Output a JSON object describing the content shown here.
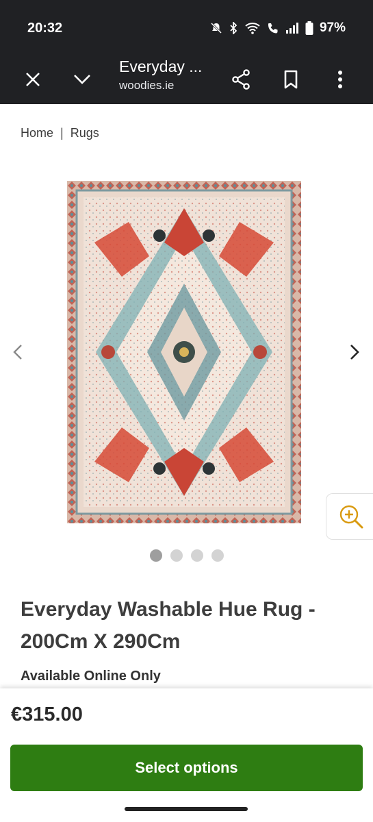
{
  "status_bar": {
    "time": "20:32",
    "battery": "97%"
  },
  "browser": {
    "page_title": "Everyday ...",
    "domain": "woodies.ie"
  },
  "breadcrumb": {
    "home": "Home",
    "separator": "|",
    "category": "Rugs"
  },
  "gallery": {
    "image_count": 4,
    "active_index": 0
  },
  "product": {
    "title": "Everyday Washable Hue Rug - 200Cm X 290Cm",
    "availability": "Available Online Only",
    "price": "€315.00",
    "cta_label": "Select options"
  },
  "colors": {
    "toolbar_bg": "#202124",
    "cta_green": "#2e7d12",
    "zoom_accent": "#d99a10"
  }
}
